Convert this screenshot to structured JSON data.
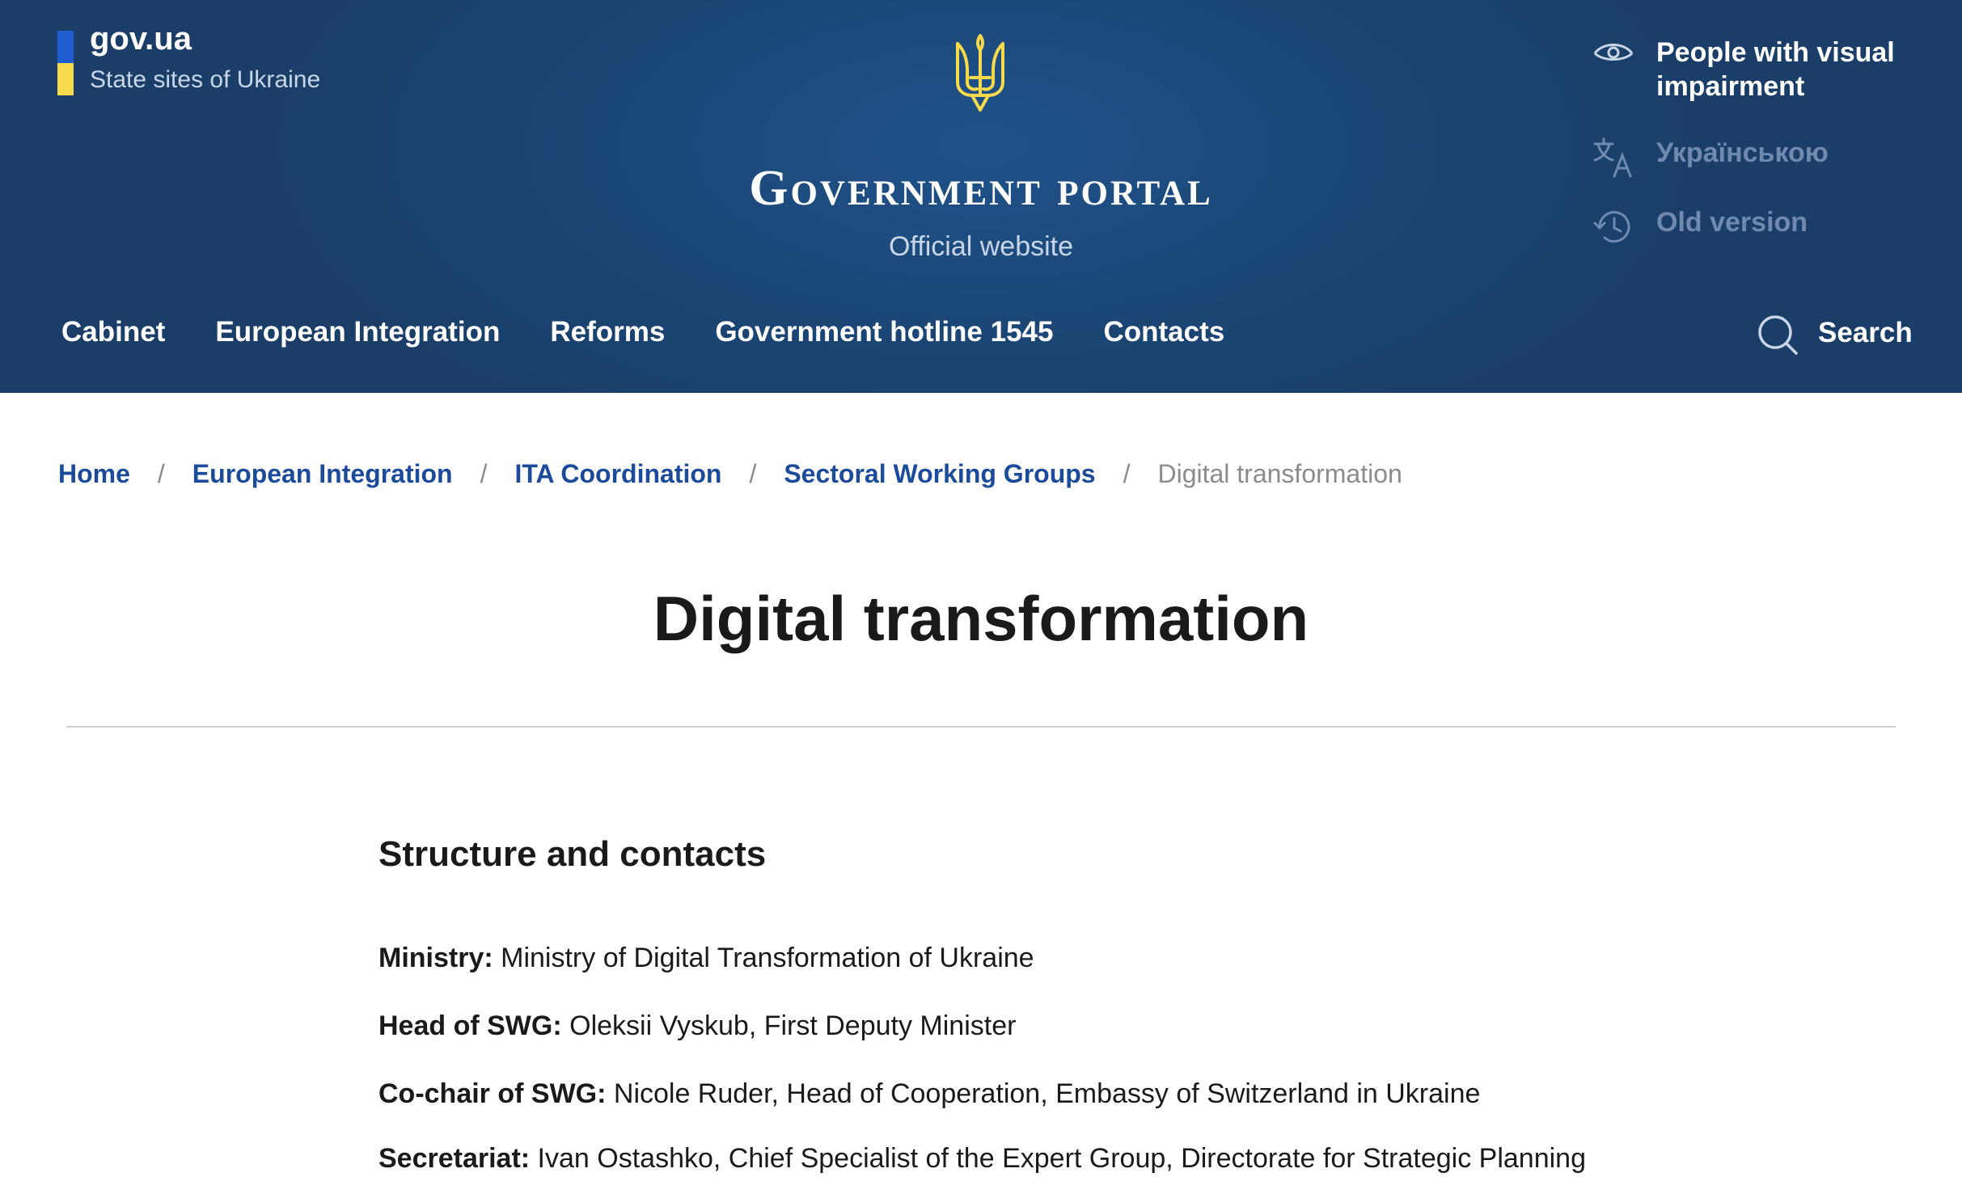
{
  "header": {
    "govua": {
      "title": "gov.ua",
      "subtitle": "State sites of Ukraine"
    },
    "portal_title": "Government portal",
    "portal_subtitle": "Official website",
    "tools": [
      {
        "label": "People with visual impairment",
        "icon": "eye-icon"
      },
      {
        "label": "Українською",
        "icon": "translate-icon"
      },
      {
        "label": "Old version",
        "icon": "history-icon"
      }
    ],
    "nav": [
      "Cabinet",
      "European Integration",
      "Reforms",
      "Government hotline 1545",
      "Contacts"
    ],
    "search_label": "Search",
    "colors": {
      "background": "#1b4675",
      "flag_blue": "#1f5bd1",
      "flag_yellow": "#f7d94c",
      "trident": "#f7d94c"
    }
  },
  "breadcrumb": {
    "items": [
      "Home",
      "European Integration",
      "ITA Coordination",
      "Sectoral Working Groups"
    ],
    "separator": "/",
    "current": "Digital transformation"
  },
  "main": {
    "title": "Digital transformation",
    "section_title": "Structure and contacts",
    "rows": [
      {
        "label": "Ministry:",
        "value": " Ministry of Digital Transformation of Ukraine"
      },
      {
        "label": "Head of SWG:",
        "value": " Oleksii Vyskub, First Deputy Minister"
      },
      {
        "label": "Co-chair of SWG:",
        "value": " Nicole Ruder, Head of Cooperation, Embassy of Switzerland in Ukraine"
      },
      {
        "label": "Secretariat:",
        "value": " Ivan Ostashko, Chief Specialist of the Expert Group, Directorate for Strategic Planning"
      }
    ]
  }
}
